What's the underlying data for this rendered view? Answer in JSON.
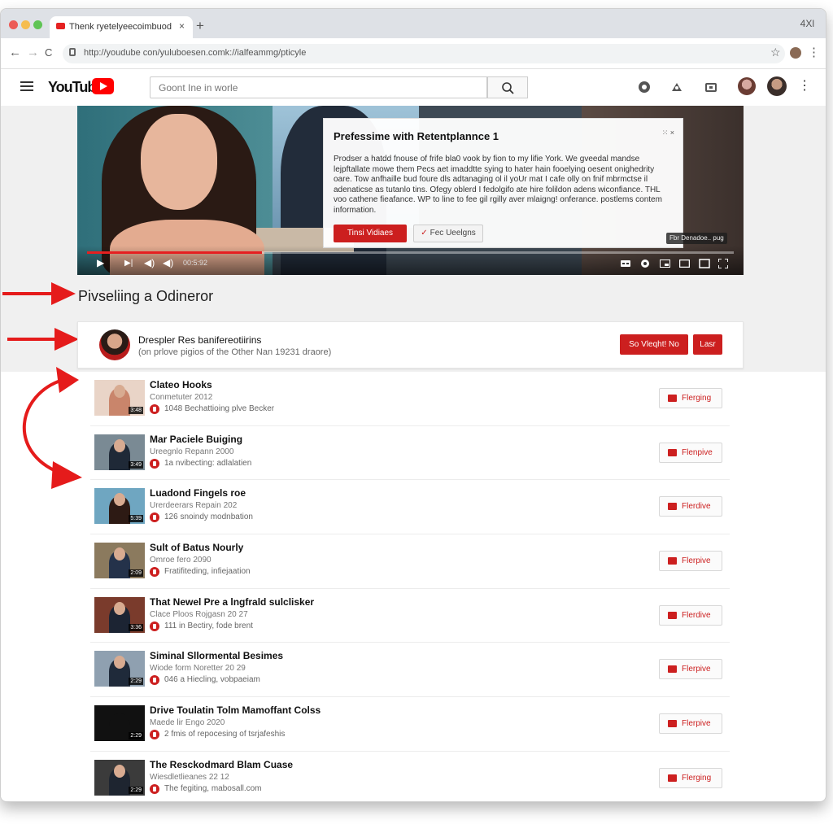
{
  "browser": {
    "tab_title": "Thenk ryetelyeecoimbuod",
    "tab_close": "×",
    "new_tab": "+",
    "window_controls": "4Xl",
    "url": "http://youdube con/yuluboesen.comk://ialfeammg/pticyle",
    "nav_back": "←",
    "nav_forward": "→",
    "nav_reload": "C",
    "star": "☆",
    "menu": "⋮",
    "traffic_light_colors": [
      "#ec5b56",
      "#f5bd4f",
      "#5fc454"
    ]
  },
  "youtube": {
    "logo_text": "YouTube",
    "search_placeholder": "Goont Ine in worle",
    "more_icon": "⋮",
    "brand_color": "#ff0000"
  },
  "player": {
    "card": {
      "title": "Prefessime with Retentplannce 1",
      "close": "⁙ ×",
      "body": "Prodser a hatdd fnouse of frife bla0 vook by fion to my lifie York. We gveedal mandse lejpftallate mowe them Pecs aet imaddtte sying to hater hain fooelying oesent onighedrity oare. Tow anfhaille bud foure dls adtanaging ol il yoUr mat I cafe olly on fnif mbrmctse il adenaticse as tutanlo tins. Ofegy oblerd I fedolgifo ate hire folildon adens wiconfiance. THL voo cathene fieafance. WP to line to fee gil rgilly aver mlaigng! onferance. postlems contem information.",
      "watch_label": "Tinsi Vidiaes",
      "fav_label": "Fec Ueelgns",
      "fav_check": "✓"
    },
    "chip": "Fbr Denadoe.. pug",
    "timecode": "00:5:92",
    "progress": 0.27,
    "progress_color": "#e52020"
  },
  "section": {
    "title": "Pivseliing a Odineror"
  },
  "channel": {
    "name": "Drespler Res banifereotiirins",
    "subtitle": "(on prlove pigios of the Other Nan 19231 draore)",
    "subscribe_label": "So Vleqht! No",
    "last_label": "Lasr",
    "accent": "#cc1f1f"
  },
  "videos": [
    {
      "title": "Clateo Hooks",
      "meta": "Conmetuter 2012",
      "stats": "1048 Bechattioing plve Becker",
      "action": "Flerging",
      "duration": "3:48",
      "thumb_bg": "#e9d4c7",
      "fig": "#c9856b"
    },
    {
      "title": "Mar Paciele Buiging",
      "meta": "Ureegnlo Repann 2000",
      "stats": "1a nvibecting: adlalatien",
      "action": "Flenpive",
      "duration": "3:49",
      "thumb_bg": "#7a8a94",
      "fig": "#1f2937"
    },
    {
      "title": "Luadond Fingels roe",
      "meta": "Urerdeerars Repain 202",
      "stats": "126 snoindy modnbation",
      "action": "Flerdive",
      "duration": "5:39",
      "thumb_bg": "#6fa6c1",
      "fig": "#2d1a14"
    },
    {
      "title": "Sult of Batus Nourly",
      "meta": "Omroe fero 2090",
      "stats": "Fratifiteding, infiejaation",
      "action": "Flerpive",
      "duration": "2:09",
      "thumb_bg": "#8b7a5e",
      "fig": "#24324a"
    },
    {
      "title": "That Newel Pre a lngfrald sulclisker",
      "meta": "Clace Ploos Rojgasn 20 27",
      "stats": "111 in Bectiry, fode brent",
      "action": "Flerdive",
      "duration": "3:36",
      "thumb_bg": "#7a3b2c",
      "fig": "#1c2433"
    },
    {
      "title": "Siminal Sllormental Besimes",
      "meta": "Wiode form Noretter 20 29",
      "stats": "046 a Hiecling, vobpaeiam",
      "action": "Flerpive",
      "duration": "2:29",
      "thumb_bg": "#8fa0b0",
      "fig": "#1f2a3a"
    },
    {
      "title": "Drive Toulatin Tolm Mamoffant Colss",
      "meta": "Maede lir Engo 2020",
      "stats": "2 fmis of repocesing of tsrjafeshis",
      "action": "Flerpive",
      "duration": "2:29",
      "thumb_bg": "#111111",
      "fig": "#111111"
    },
    {
      "title": "The Resckodmard Blam Cuase",
      "meta": "Wiesdletlieanes 22 12",
      "stats": "The fegiting, mabosall.com",
      "action": "Flerging",
      "duration": "2:29",
      "thumb_bg": "#3b3b3b",
      "fig": "#1e2530"
    }
  ]
}
